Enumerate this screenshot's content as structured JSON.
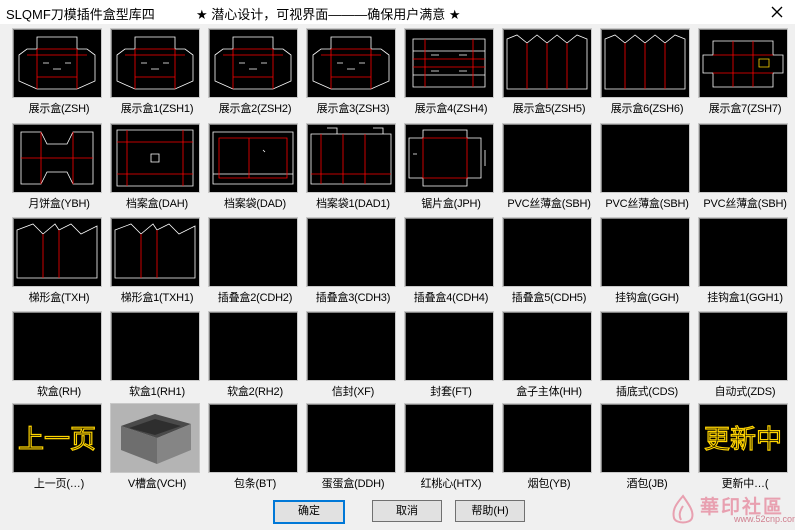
{
  "window": {
    "title": "SLQMF刀模插件盒型库四",
    "slogan": "★ 潜心设计，可视界面———确保用户满意 ★",
    "close_icon": "close-icon"
  },
  "colors": {
    "thumb_bg": "#000000",
    "die_line_white": "#ffffff",
    "die_line_red": "#ff0000",
    "nav_text_yellow": "#ffd400",
    "default_button_border": "#0078d7"
  },
  "items": [
    {
      "label": "展示盒(ZSH)",
      "thumb": "die-display"
    },
    {
      "label": "展示盒1(ZSH1)",
      "thumb": "die-display"
    },
    {
      "label": "展示盒2(ZSH2)",
      "thumb": "die-display"
    },
    {
      "label": "展示盒3(ZSH3)",
      "thumb": "die-display"
    },
    {
      "label": "展示盒4(ZSH4)",
      "thumb": "die-display-wide"
    },
    {
      "label": "展示盒5(ZSH5)",
      "thumb": "die-trapezoid"
    },
    {
      "label": "展示盒6(ZSH6)",
      "thumb": "die-trapezoid"
    },
    {
      "label": "展示盒7(ZSH7)",
      "thumb": "die-display7"
    },
    {
      "label": "月饼盒(YBH)",
      "thumb": "die-mooncake"
    },
    {
      "label": "档案盒(DAH)",
      "thumb": "die-file-box"
    },
    {
      "label": "档案袋(DAD)",
      "thumb": "die-file-bag"
    },
    {
      "label": "档案袋1(DAD1)",
      "thumb": "die-file-bag1"
    },
    {
      "label": "锯片盒(JPH)",
      "thumb": "die-saw"
    },
    {
      "label": "PVC丝薄盒(SBH)",
      "thumb": "blank"
    },
    {
      "label": "PVC丝薄盒(SBH)",
      "thumb": "blank"
    },
    {
      "label": "PVC丝薄盒(SBH)",
      "thumb": "blank"
    },
    {
      "label": "梯形盒(TXH)",
      "thumb": "die-ladder"
    },
    {
      "label": "梯形盒1(TXH1)",
      "thumb": "die-ladder"
    },
    {
      "label": "插叠盒2(CDH2)",
      "thumb": "blank"
    },
    {
      "label": "插叠盒3(CDH3)",
      "thumb": "blank"
    },
    {
      "label": "插叠盒4(CDH4)",
      "thumb": "blank"
    },
    {
      "label": "插叠盒5(CDH5)",
      "thumb": "blank"
    },
    {
      "label": "挂钩盒(GGH)",
      "thumb": "blank"
    },
    {
      "label": "挂钩盒1(GGH1)",
      "thumb": "blank"
    },
    {
      "label": "软盒(RH)",
      "thumb": "blank"
    },
    {
      "label": "软盒1(RH1)",
      "thumb": "blank"
    },
    {
      "label": "软盒2(RH2)",
      "thumb": "blank"
    },
    {
      "label": "信封(XF)",
      "thumb": "blank"
    },
    {
      "label": "封套(FT)",
      "thumb": "blank"
    },
    {
      "label": "盒子主体(HH)",
      "thumb": "blank"
    },
    {
      "label": "插底式(CDS)",
      "thumb": "blank"
    },
    {
      "label": "自动式(ZDS)",
      "thumb": "blank"
    },
    {
      "label": "上一页(…)",
      "thumb": "prev-page",
      "thumb_text": "上一页"
    },
    {
      "label": "V槽盒(VCH)",
      "thumb": "photo-vgroove-box"
    },
    {
      "label": "包条(BT)",
      "thumb": "blank"
    },
    {
      "label": "蛋蛋盒(DDH)",
      "thumb": "blank"
    },
    {
      "label": "红桃心(HTX)",
      "thumb": "blank"
    },
    {
      "label": "烟包(YB)",
      "thumb": "blank"
    },
    {
      "label": "酒包(JB)",
      "thumb": "blank"
    },
    {
      "label": "更新中…(",
      "thumb": "updating",
      "thumb_text": "更新中"
    }
  ],
  "buttons": {
    "ok": "确定",
    "cancel": "取消",
    "help": "帮助(H)"
  },
  "watermark": {
    "text": "華印社區",
    "url": "www.52cnp.com",
    "logo": "flame-logo-icon"
  }
}
